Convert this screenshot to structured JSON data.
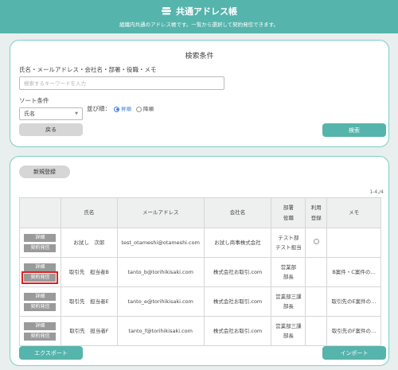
{
  "header": {
    "title": "共通アドレス帳",
    "subtitle": "組織内共通のアドレス帳です。一覧から選択して契約発信できます。"
  },
  "search": {
    "title": "検索条件",
    "keyword_label": "氏名・メールアドレス・会社名・部署・役職・メモ",
    "keyword_placeholder": "検索するキーワードを入力",
    "sort_label": "ソート条件",
    "sort_value": "氏名",
    "order_label": "並び順：",
    "order_options": [
      "昇順",
      "降順"
    ],
    "order_selected": "昇順",
    "back_button": "戻る",
    "search_button": "検索"
  },
  "list": {
    "new_button": "新規登録",
    "count": "1-4,/4",
    "columns": {
      "name": "氏名",
      "email": "メールアドレス",
      "company": "会社名",
      "dept_line1": "部署",
      "dept_line2": "役職",
      "use_line1": "利用",
      "use_line2": "登録",
      "memo": "メモ"
    },
    "detail_label": "詳細",
    "send_label": "契約発信",
    "rows": [
      {
        "name": "お試し　次郎",
        "email": "test_otameshi@otameshi.com",
        "company": "お試し商事株式会社",
        "dept": "テスト部",
        "role": "テスト担当",
        "memo": ""
      },
      {
        "name": "取引先　担当者B",
        "email": "tanto_b@torihikisaki.com",
        "company": "株式会社お取引.com",
        "dept": "営業部",
        "role": "部長",
        "memo": "B案件・C案件の…"
      },
      {
        "name": "取引先　担当者E",
        "email": "tanto_e@torihikisaki.com",
        "company": "株式会社お取引.com",
        "dept": "営業部三課",
        "role": "部長",
        "memo": "取引先のE案件の…"
      },
      {
        "name": "取引先　担当者F",
        "email": "tanto_f@torihikisaki.com",
        "company": "株式会社お取引.com",
        "dept": "営業部三課",
        "role": "部長",
        "memo": "取引先のF案件の…"
      }
    ],
    "export_button": "エクスポート",
    "import_button": "インポート"
  },
  "colors": {
    "accent": "#55b4ac",
    "panel_border": "#7fcfc6",
    "highlight": "#e02020"
  }
}
